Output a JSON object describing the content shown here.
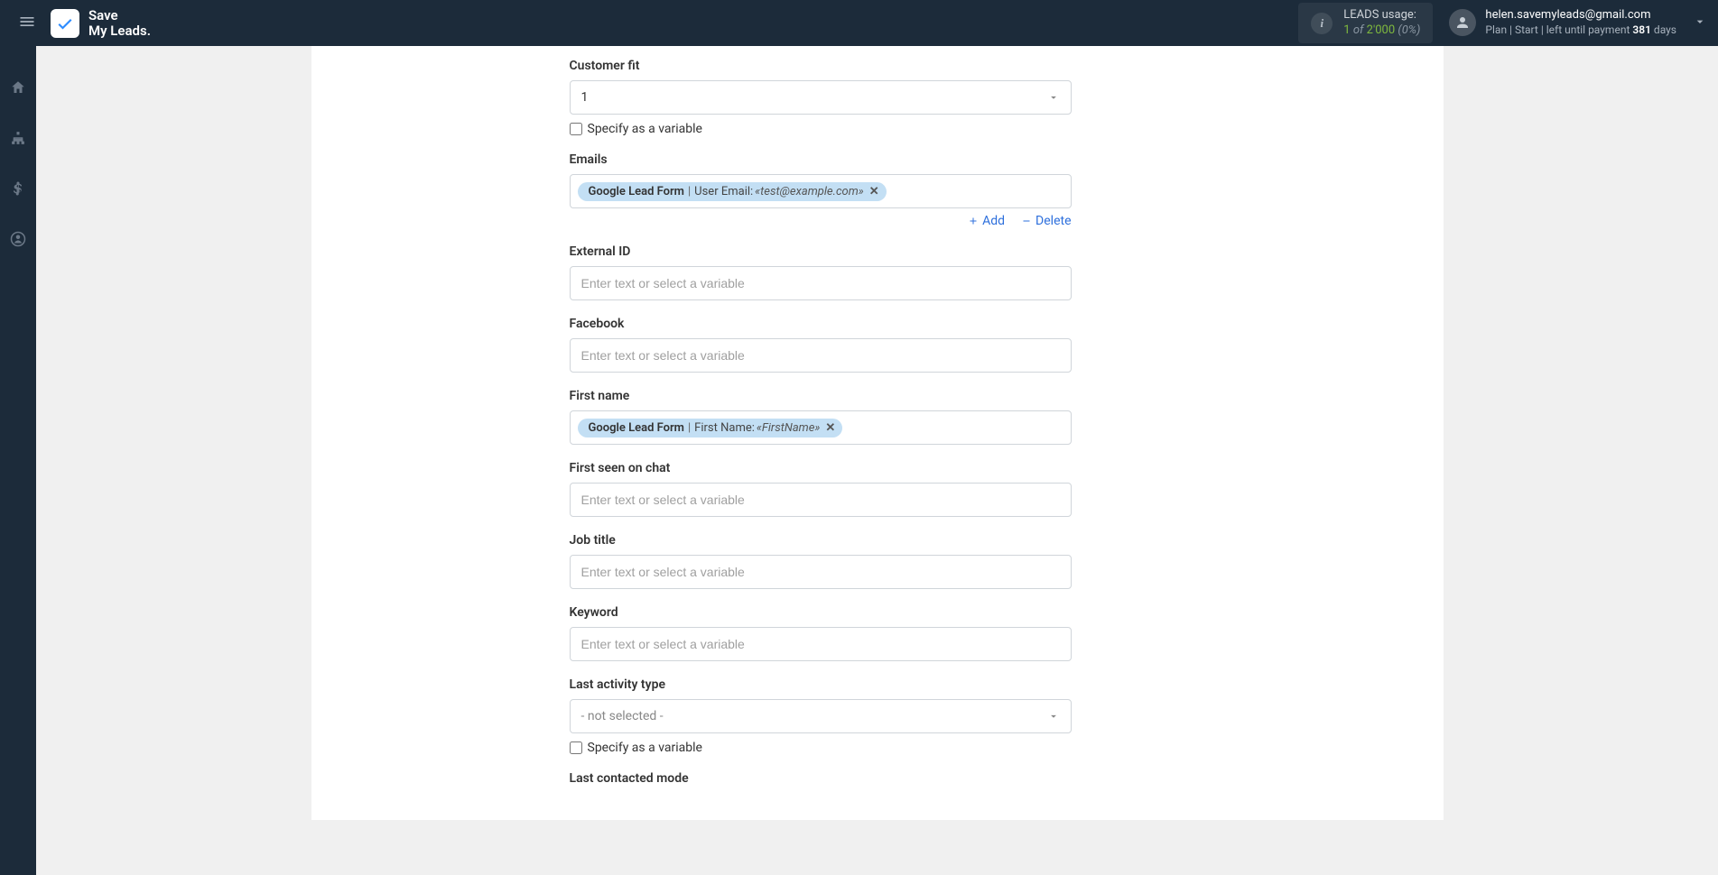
{
  "header": {
    "logo_line1": "Save",
    "logo_line2": "My Leads.",
    "usage_label": "LEADS usage:",
    "usage_current": "1",
    "usage_of": "of",
    "usage_total": "2'000",
    "usage_pct": "(0%)",
    "user_email": "helen.savemyleads@gmail.com",
    "plan_prefix": "Plan |",
    "plan_name": "Start",
    "plan_mid": "| left until payment",
    "plan_days_num": "381",
    "plan_days_suffix": "days"
  },
  "placeholders": {
    "text_var": "Enter text or select a variable"
  },
  "fields": {
    "customer_fit": {
      "label": "Customer fit",
      "value": "1",
      "specify": "Specify as a variable"
    },
    "emails": {
      "label": "Emails",
      "token_source": "Google Lead Form",
      "token_field": "User Email:",
      "token_value": "«test@example.com»",
      "add": "Add",
      "delete": "Delete"
    },
    "external_id": {
      "label": "External ID"
    },
    "facebook": {
      "label": "Facebook"
    },
    "first_name": {
      "label": "First name",
      "token_source": "Google Lead Form",
      "token_field": "First Name:",
      "token_value": "«FirstName»"
    },
    "first_seen": {
      "label": "First seen on chat"
    },
    "job_title": {
      "label": "Job title"
    },
    "keyword": {
      "label": "Keyword"
    },
    "last_activity": {
      "label": "Last activity type",
      "value": "- not selected -",
      "specify": "Specify as a variable"
    },
    "last_contacted": {
      "label": "Last contacted mode"
    }
  }
}
